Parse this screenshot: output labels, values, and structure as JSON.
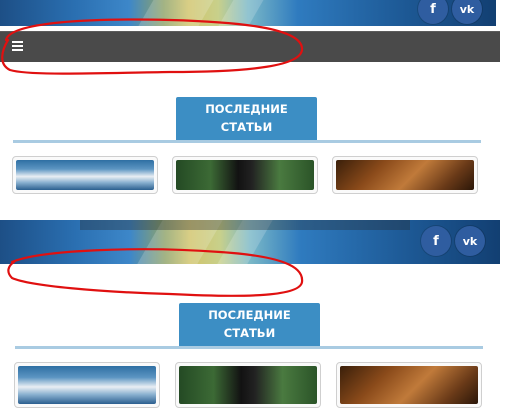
{
  "screens": [
    {
      "id": "before",
      "social": {
        "facebook_glyph": "f",
        "vk_glyph": "vk"
      },
      "nav": {
        "menu_icon": "hamburger-icon"
      },
      "section": {
        "title": "ПОСЛЕДНИЕ СТАТЬИ",
        "title_line1": "ПОСЛЕДНИЕ",
        "title_line2": "СТАТЬИ"
      },
      "thumbnails": [
        "port-thumbnail",
        "dog-thumbnail",
        "puppy-thumbnail"
      ]
    },
    {
      "id": "after",
      "social": {
        "facebook_glyph": "f",
        "vk_glyph": "vk"
      },
      "section": {
        "title": "ПОСЛЕДНИЕ СТАТЬИ",
        "title_line1": "ПОСЛЕДНИЕ",
        "title_line2": "СТАТЬИ"
      },
      "thumbnails": [
        "port-thumbnail",
        "dog-thumbnail",
        "puppy-thumbnail"
      ]
    }
  ],
  "colors": {
    "navbar": "#4a4a4a",
    "tab": "#3c8ec4",
    "rule": "#a9cbe2",
    "social": "#2f5da0",
    "annotation": "#e01010"
  }
}
